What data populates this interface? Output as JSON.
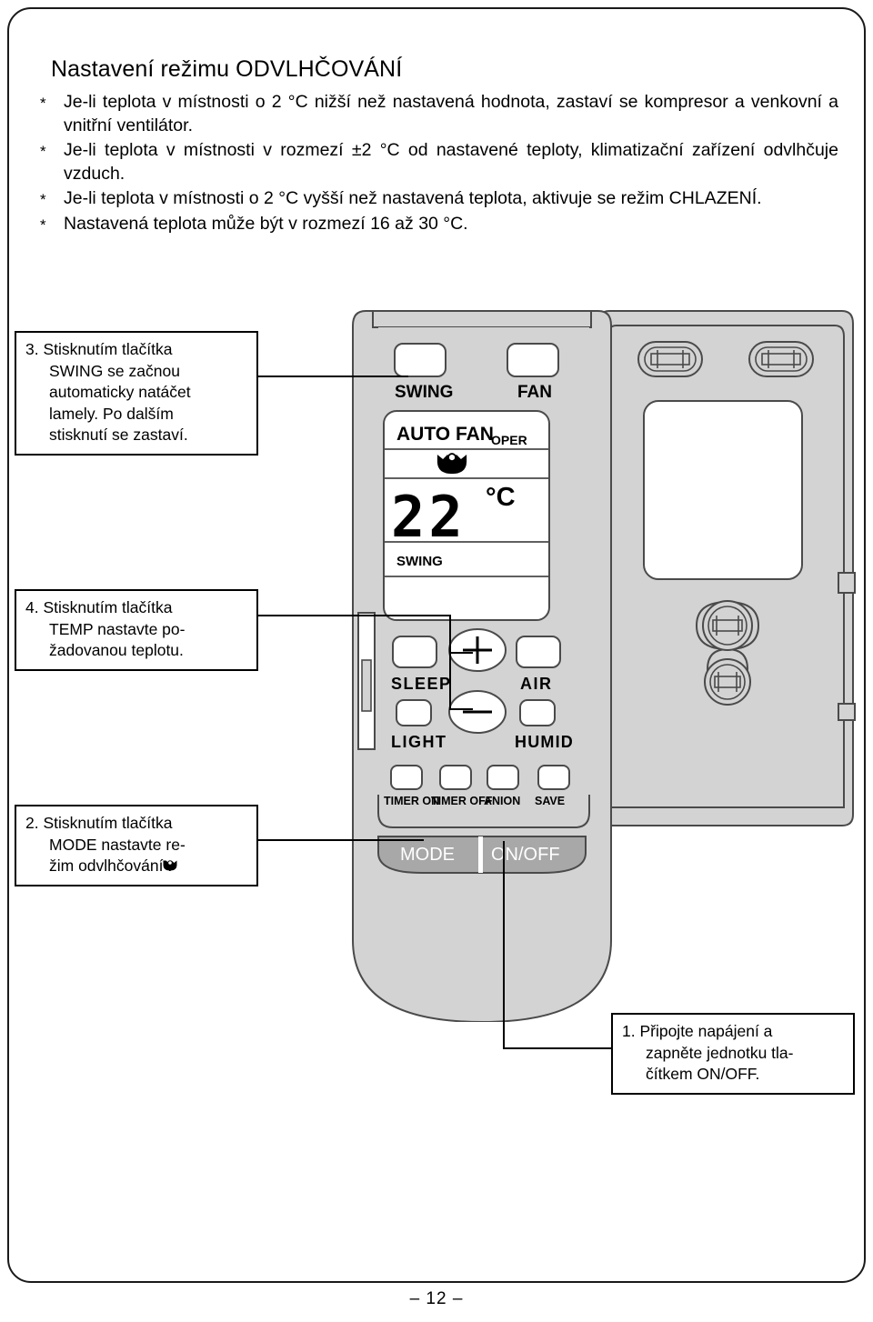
{
  "page": {
    "number_label": "– 12 –",
    "heading": "Nastavení režimu ODVLHČOVÁNÍ"
  },
  "intro_bullets": [
    {
      "marker": "*",
      "text": "Je-li teplota v místnosti o 2 °C nižší než nastavená hodnota, zastaví se kompresor a venkovní a vnitřní ventilátor."
    },
    {
      "marker": "*",
      "text": "Je-li teplota v místnosti v rozmezí ±2 °C od nastavené teploty, klimatizační zařízení odvlhčuje vzduch."
    },
    {
      "marker": "*",
      "text": "Je-li teplota v místnosti o 2 °C vyšší než nastavená teplota, aktivuje se režim CHLAZENÍ."
    },
    {
      "marker": "*",
      "text": "Nastavená teplota může být v rozmezí 16 až 30 °C."
    }
  ],
  "callouts": {
    "step1": {
      "line1": "1. Připojte napájení a",
      "line2": "zapněte jednotku tla-",
      "line3": "čítkem ON/OFF."
    },
    "step2": {
      "line1": "2. Stisknutím tlačítka",
      "line2": "MODE nastavte re-",
      "line3": "žim odvlhčování ."
    },
    "step3": {
      "line1": "3. Stisknutím tlačítka",
      "line2": "SWING se začnou",
      "line3": "automaticky natáčet",
      "line4": "lamely. Po dalším",
      "line5": "stisknutí se zastaví."
    },
    "step4": {
      "line1": "4. Stisknutím tlačítka",
      "line2": "TEMP nastavte po-",
      "line3": "žadovanou teplotu."
    }
  },
  "remote": {
    "top_buttons": [
      {
        "label": "SWING",
        "name": "swing-button"
      },
      {
        "label": "FAN",
        "name": "fan-button"
      }
    ],
    "display": {
      "fan_mode": "AUTO FAN",
      "oper": "OPER",
      "mode_icon": "dehumidify-icon",
      "temperature": "22",
      "degree_unit": "°C",
      "swing_indicator": "SWING"
    },
    "mid_buttons": [
      {
        "label": "SLEEP",
        "name": "sleep-button"
      },
      {
        "label": "AIR",
        "name": "air-button"
      },
      {
        "label": "LIGHT",
        "name": "light-button"
      },
      {
        "label": "HUMID",
        "name": "humid-button"
      }
    ],
    "temp_up": "+",
    "temp_down": "−",
    "bottom_buttons": [
      {
        "label": "TIMER ON",
        "name": "timer-on-button"
      },
      {
        "label": "TIMER OFF",
        "name": "timer-off-button"
      },
      {
        "label": "ANION",
        "name": "anion-button"
      },
      {
        "label": "SAVE",
        "name": "save-button"
      }
    ],
    "bar_buttons": [
      {
        "label": "MODE",
        "name": "mode-button"
      },
      {
        "label": "ON/OFF",
        "name": "onoff-button"
      }
    ]
  },
  "colors": {
    "body_gray": "#d3d3d3",
    "bar_gray": "#a8a8a8",
    "outline": "#333333",
    "text": "#000000"
  }
}
